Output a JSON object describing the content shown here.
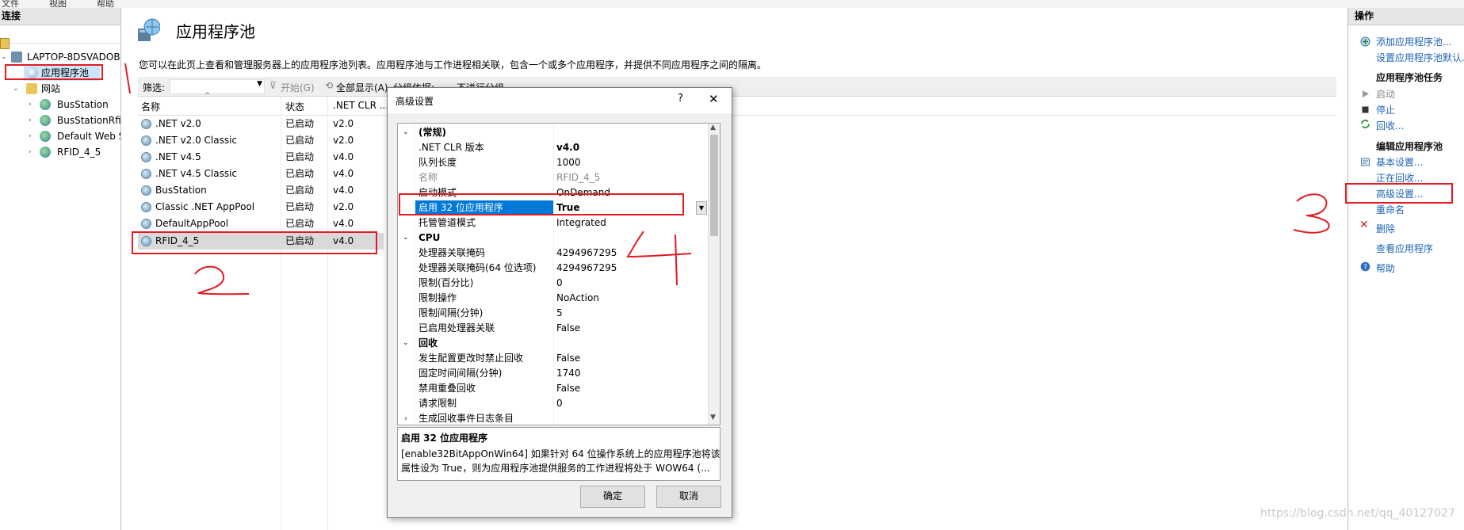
{
  "menu": {
    "items": [
      "文件",
      "视图",
      "帮助"
    ]
  },
  "connections": {
    "title": "连接",
    "tree": [
      {
        "label": "LAPTOP-8DSVADOB",
        "level": 0
      },
      {
        "label": "应用程序池",
        "level": 1
      },
      {
        "label": "网站",
        "level": 1
      },
      {
        "label": "BusStation",
        "level": 2
      },
      {
        "label": "BusStationRfid",
        "level": 2
      },
      {
        "label": "Default Web S",
        "level": 2
      },
      {
        "label": "RFID_4_5",
        "level": 2
      }
    ]
  },
  "main": {
    "title": "应用程序池",
    "description": "您可以在此页上查看和管理服务器上的应用程序池列表。应用程序池与工作进程相关联，包含一个或多个应用程序，并提供不同应用程序之间的隔离。",
    "filter_label": "筛选:",
    "start_label": "开始(G)",
    "show_all_label": "全部显示(A)",
    "group_by_label": "分组依据:",
    "group_by_value": "不进行分组",
    "columns": [
      "名称",
      "状态",
      ".NET CLR ..."
    ],
    "rows": [
      {
        "name": ".NET v2.0",
        "status": "已启动",
        "clr": "v2.0"
      },
      {
        "name": ".NET v2.0 Classic",
        "status": "已启动",
        "clr": "v2.0"
      },
      {
        "name": ".NET v4.5",
        "status": "已启动",
        "clr": "v4.0"
      },
      {
        "name": ".NET v4.5 Classic",
        "status": "已启动",
        "clr": "v4.0"
      },
      {
        "name": "BusStation",
        "status": "已启动",
        "clr": "v4.0"
      },
      {
        "name": "Classic .NET AppPool",
        "status": "已启动",
        "clr": "v2.0"
      },
      {
        "name": "DefaultAppPool",
        "status": "已启动",
        "clr": "v4.0"
      },
      {
        "name": "RFID_4_5",
        "status": "已启动",
        "clr": "v4.0"
      }
    ]
  },
  "actions": {
    "title": "操作",
    "add_pool": "添加应用程序池...",
    "set_defaults": "设置应用程序池默认...",
    "section_tasks": "应用程序池任务",
    "start": "启动",
    "stop": "停止",
    "recycle": "回收...",
    "section_edit": "编辑应用程序池",
    "basic_settings": "基本设置...",
    "recycling": "正在回收...",
    "advanced_settings": "高级设置...",
    "rename": "重命名",
    "delete": "删除",
    "view_apps": "查看应用程序",
    "help": "帮助"
  },
  "dialog": {
    "title": "高级设置",
    "help_glyph": "?",
    "close_glyph": "✕",
    "properties": [
      {
        "type": "cat",
        "label": "(常规)"
      },
      {
        "type": "prop",
        "label": ".NET CLR 版本",
        "value": "v4.0",
        "bold": true
      },
      {
        "type": "prop",
        "label": "队列长度",
        "value": "1000"
      },
      {
        "type": "prop",
        "label": "名称",
        "value": "RFID_4_5",
        "gray": true
      },
      {
        "type": "prop",
        "label": "启动模式",
        "value": "OnDemand"
      },
      {
        "type": "prop",
        "label": "启用 32 位应用程序",
        "value": "True",
        "bold": true,
        "selected": true
      },
      {
        "type": "prop",
        "label": "托管管道模式",
        "value": "Integrated"
      },
      {
        "type": "cat",
        "label": "CPU"
      },
      {
        "type": "prop",
        "label": "处理器关联掩码",
        "value": "4294967295"
      },
      {
        "type": "prop",
        "label": "处理器关联掩码(64 位选项)",
        "value": "4294967295"
      },
      {
        "type": "prop",
        "label": "限制(百分比)",
        "value": "0"
      },
      {
        "type": "prop",
        "label": "限制操作",
        "value": "NoAction"
      },
      {
        "type": "prop",
        "label": "限制间隔(分钟)",
        "value": "5"
      },
      {
        "type": "prop",
        "label": "已启用处理器关联",
        "value": "False"
      },
      {
        "type": "cat",
        "label": "回收"
      },
      {
        "type": "prop",
        "label": "发生配置更改时禁止回收",
        "value": "False"
      },
      {
        "type": "prop",
        "label": "固定时间间隔(分钟)",
        "value": "1740"
      },
      {
        "type": "prop",
        "label": "禁用重叠回收",
        "value": "False"
      },
      {
        "type": "prop",
        "label": "请求限制",
        "value": "0"
      },
      {
        "type": "prop",
        "label": "生成回收事件日志条目",
        "value": "",
        "expander": true
      }
    ],
    "desc_title": "启用 32 位应用程序",
    "desc_line1": "[enable32BitAppOnWin64] 如果针对 64 位操作系统上的应用程序池将该",
    "desc_line2": "属性设为 True，则为应用程序池提供服务的工作进程将处于 WOW64 (...",
    "ok": "确定",
    "cancel": "取消"
  },
  "watermark": "https://blog.csdn.net/qq_40127027"
}
